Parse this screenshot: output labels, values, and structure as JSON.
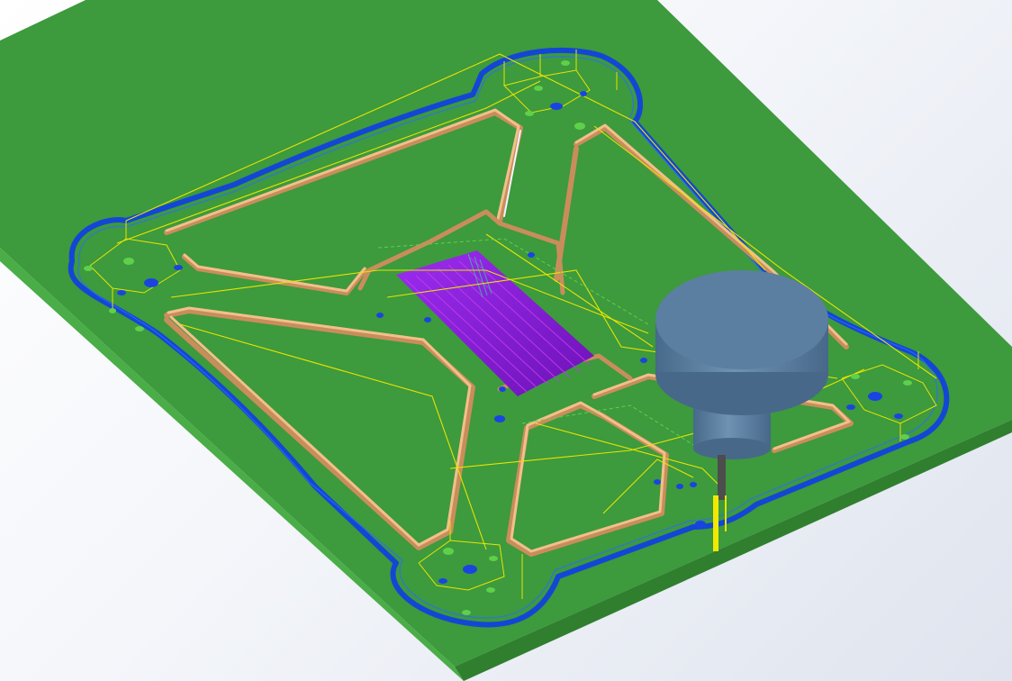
{
  "viewport": {
    "name": "cam-toolpath-simulation-viewport"
  },
  "colors": {
    "background": "#eef1f6",
    "stock_top": "#3d9a3d",
    "stock_side": "#2f7f2f",
    "stock_front": "#4aad47",
    "outer_contour": "#1446d6",
    "inner_slot_edge": "#f2c08a",
    "inner_slot_shadow": "#c98d5c",
    "toolpath_rapid": "#e8e400",
    "toolpath_feed_dashed": "#5fd04a",
    "pocket_fill": "#8a20d8",
    "pocket_lines": "#c03ee8",
    "hole_marker": "#1a44e0",
    "spindle": "#5b7fa0",
    "spindle_dark": "#48688a",
    "tool_shank": "#4d4d4d",
    "tool_tip": "#f2e800"
  },
  "icons": {
    "spindle": "spindle-head-icon",
    "tool": "end-mill-tool-icon"
  }
}
